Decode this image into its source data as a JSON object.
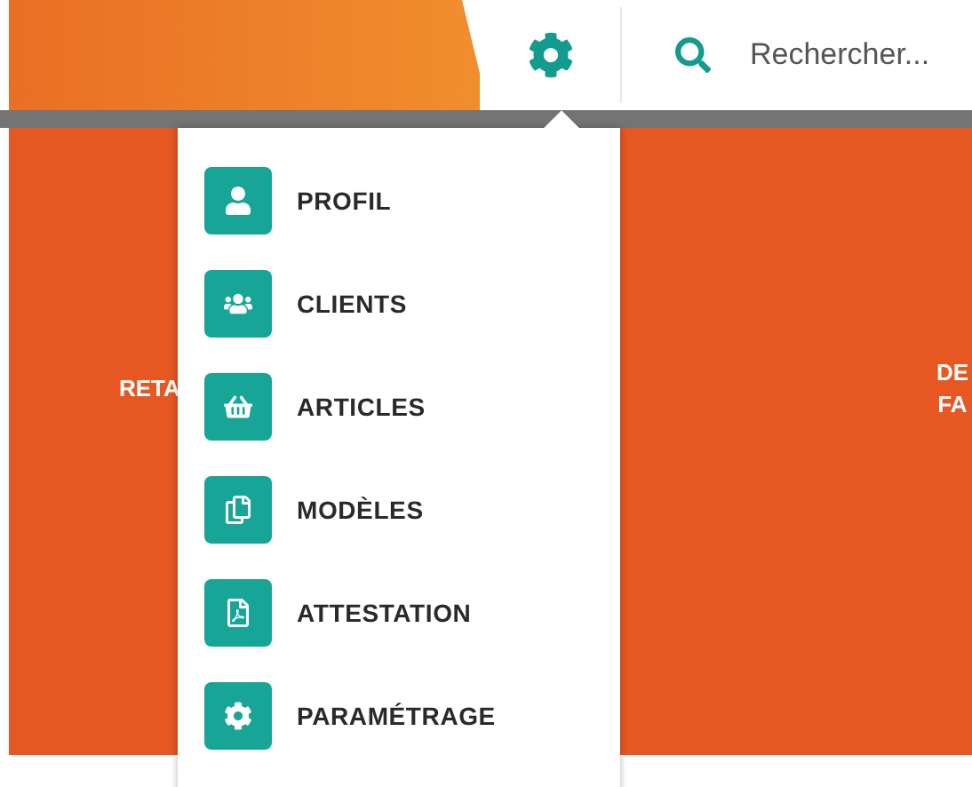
{
  "header": {
    "search": {
      "placeholder": "Rechercher..."
    }
  },
  "tiles": [
    {
      "lines": [
        "RETA"
      ]
    },
    {
      "lines": [
        "DE",
        "FA"
      ]
    }
  ],
  "settings_menu": {
    "items": [
      {
        "label": "PROFIL",
        "kind": "user"
      },
      {
        "label": "CLIENTS",
        "kind": "users"
      },
      {
        "label": "ARTICLES",
        "kind": "basket"
      },
      {
        "label": "MODÈLES",
        "kind": "copy"
      },
      {
        "label": "ATTESTATION",
        "kind": "pdf"
      },
      {
        "label": "PARAMÉTRAGE",
        "kind": "gear"
      }
    ]
  }
}
